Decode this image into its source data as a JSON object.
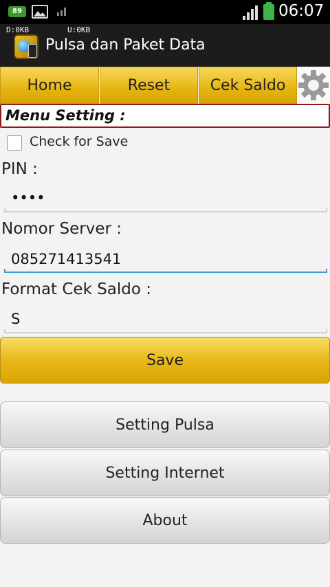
{
  "statusbar": {
    "notification_count": "89",
    "time": "06:07",
    "icons": [
      "battery-badge-icon",
      "gallery-icon",
      "signal-small-icon",
      "signal-icon",
      "battery-icon"
    ]
  },
  "appbar": {
    "traffic_down": "D:0KB",
    "traffic_up": "U:0KB",
    "title": "Pulsa dan Paket Data"
  },
  "tabs": [
    {
      "label": "Home"
    },
    {
      "label": "Reset"
    },
    {
      "label": "Cek Saldo"
    }
  ],
  "settings": {
    "section_title": "Menu Setting :",
    "checkbox_label": "Check for Save",
    "pin_label": "PIN :",
    "pin_value": "••••",
    "server_label": "Nomor Server :",
    "server_value": "085271413541",
    "format_label": "Format Cek Saldo :",
    "format_value": "S",
    "save_label": "Save"
  },
  "menu": [
    {
      "label": "Setting Pulsa"
    },
    {
      "label": "Setting Internet"
    },
    {
      "label": "About"
    }
  ],
  "colors": {
    "accent_gold": "#e6b510",
    "focus_blue": "#3f9bd6",
    "section_border": "#8e1a1a"
  }
}
